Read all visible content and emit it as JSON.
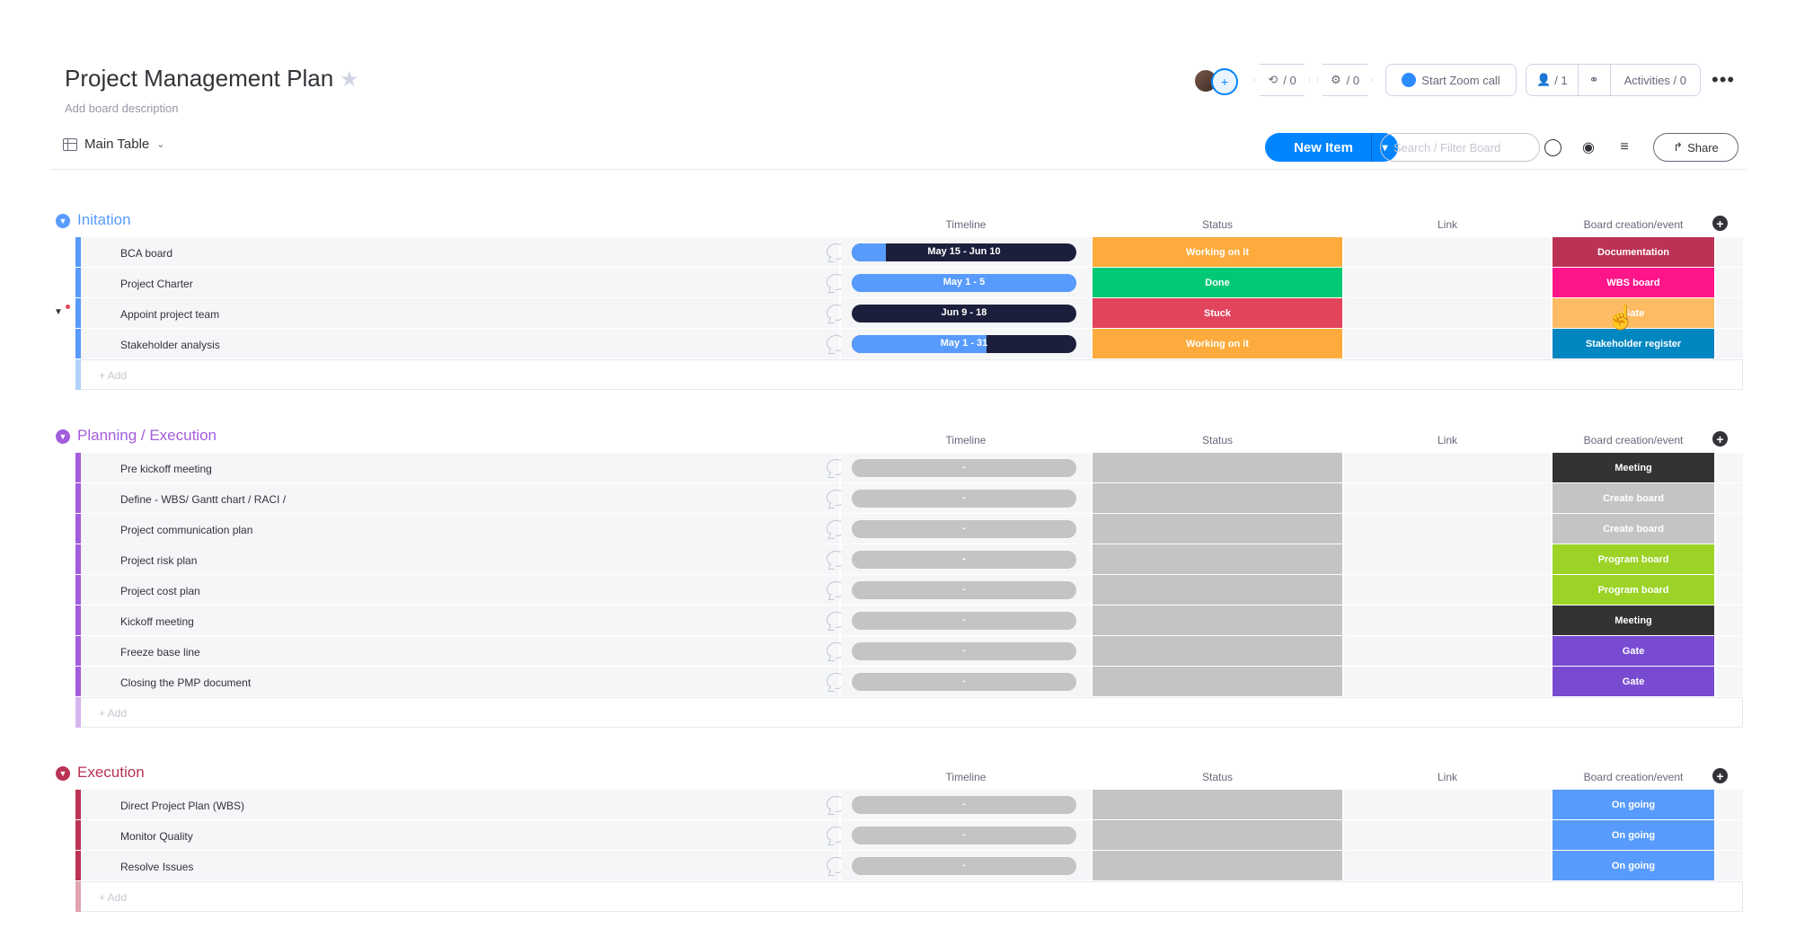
{
  "header": {
    "title": "Project Management Plan",
    "description": "Add board description",
    "updates_count": "/ 0",
    "automations_count": "/ 0",
    "zoom_label": "Start Zoom call",
    "members_count": "/ 1",
    "activities_label": "Activities / 0"
  },
  "toolbar": {
    "view_label": "Main Table",
    "new_item_label": "New Item",
    "search_placeholder": "Search / Filter Board",
    "share_label": "Share"
  },
  "columns": {
    "timeline": "Timeline",
    "status": "Status",
    "link": "Link",
    "board": "Board creation/event"
  },
  "add_label": "+ Add",
  "colors": {
    "initiation": "#579bfc",
    "planning": "#a25ddc",
    "execution": "#bb3354",
    "working": "#fdab3d",
    "done": "#00c875",
    "stuck": "#e2445c",
    "navy": "#1c1f3b",
    "blue": "#579bfc",
    "empty": "#c4c4c4"
  },
  "groups": [
    {
      "title": "Initation",
      "color": "#579bfc",
      "rows": [
        {
          "name": "BCA board",
          "timeline": "May 15 - Jun 10",
          "tl_progress": 0.15,
          "status": "Working on it",
          "status_color": "#fdab3d",
          "board": "Documentation",
          "board_color": "#bb3354"
        },
        {
          "name": "Project Charter",
          "timeline": "May 1 - 5",
          "tl_progress": 1.0,
          "status": "Done",
          "status_color": "#00c875",
          "board": "WBS board",
          "board_color": "#ff158a"
        },
        {
          "name": "Appoint project team",
          "timeline": "Jun 9 - 18",
          "tl_progress": 0.0,
          "status": "Stuck",
          "status_color": "#e2445c",
          "board": "Gate",
          "board_color": "#fdbc64"
        },
        {
          "name": "Stakeholder analysis",
          "timeline": "May 1 - 31",
          "tl_progress": 0.6,
          "status": "Working on it",
          "status_color": "#fdab3d",
          "board": "Stakeholder register",
          "board_color": "#0086c0"
        }
      ]
    },
    {
      "title": "Planning / Execution",
      "color": "#a25ddc",
      "rows": [
        {
          "name": "Pre kickoff meeting",
          "timeline": "-",
          "status": "",
          "board": "Meeting",
          "board_color": "#333333"
        },
        {
          "name": "Define - WBS/ Gantt chart / RACI /",
          "timeline": "-",
          "status": "",
          "board": "Create board",
          "board_color": "#c4c4c4"
        },
        {
          "name": "Project communication plan",
          "timeline": "-",
          "status": "",
          "board": "Create board",
          "board_color": "#c4c4c4"
        },
        {
          "name": "Project risk plan",
          "timeline": "-",
          "status": "",
          "board": "Program board",
          "board_color": "#9cd326"
        },
        {
          "name": "Project cost plan",
          "timeline": "-",
          "status": "",
          "board": "Program board",
          "board_color": "#9cd326"
        },
        {
          "name": "Kickoff meeting",
          "timeline": "-",
          "status": "",
          "board": "Meeting",
          "board_color": "#333333"
        },
        {
          "name": "Freeze base line",
          "timeline": "-",
          "status": "",
          "board": "Gate",
          "board_color": "#784bd1"
        },
        {
          "name": "Closing the PMP document",
          "timeline": "-",
          "status": "",
          "board": "Gate",
          "board_color": "#784bd1"
        }
      ]
    },
    {
      "title": "Execution",
      "color": "#bb3354",
      "rows": [
        {
          "name": "Direct Project Plan (WBS)",
          "timeline": "-",
          "status": "",
          "board": "On going",
          "board_color": "#579bfc"
        },
        {
          "name": "Monitor Quality",
          "timeline": "-",
          "status": "",
          "board": "On going",
          "board_color": "#579bfc"
        },
        {
          "name": "Resolve Issues",
          "timeline": "-",
          "status": "",
          "board": "On going",
          "board_color": "#579bfc"
        }
      ]
    }
  ]
}
